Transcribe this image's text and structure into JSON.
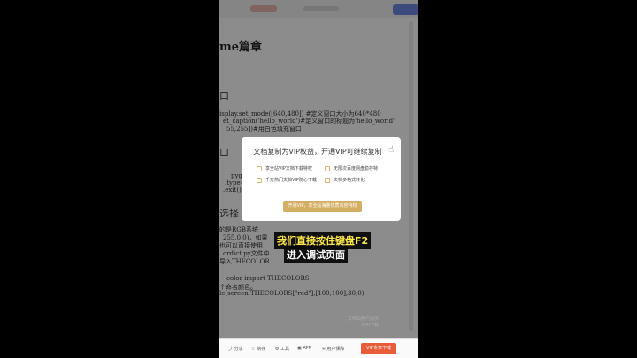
{
  "document": {
    "heading": "me篇章",
    "lines": [
      "isplay.set_mode([640,480])  #定义窗口大小为640*480",
      "et_caption('hello_world')#定义窗口的标题为'hello_world'",
      "55,255])#用白色填充窗口",
      "pygame",
      ".type==p",
      ".exit()",
      "的是RGB系统",
      "255,0,0)，如果",
      "也可以直接使用",
      "ordict.py文件中",
      "导入THECOLOR",
      "color  import  THECOLORS",
      "个命名颜色。",
      "le(screen,THECOLORS[\"red\"],[100,100],30,0)"
    ],
    "section_chars": [
      "口",
      "口",
      "选择"
    ]
  },
  "modal": {
    "title": "文档复制为VIP权益，开通VIP可继续复制",
    "features": [
      "享全站VIP文档下载特权",
      "无限次百度网盘稳存特",
      "千万热门文档VIP随心下载",
      "文档多格式转化"
    ],
    "cta": "开通VIP，享全站海量优质内容特权"
  },
  "captions": {
    "line1": "我们直接按住键盘F2",
    "line2": "进入调试页面"
  },
  "bottom_bar": {
    "items": [
      "分享",
      "纳存",
      "工具",
      "APP",
      "用户保障"
    ],
    "download_button": "VIP专享下载"
  },
  "watermark": {
    "line1": "文档由用户提供",
    "line2": "MAI下载"
  }
}
